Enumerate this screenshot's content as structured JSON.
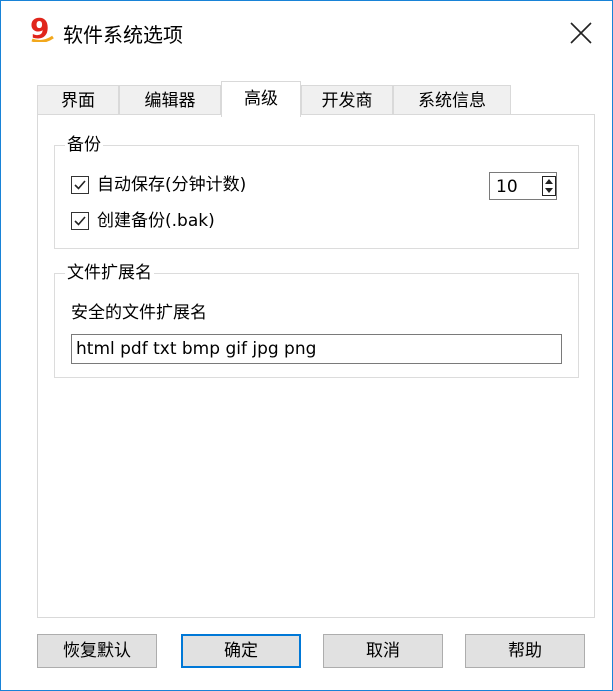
{
  "window": {
    "title": "软件系统选项",
    "app_icon_glyph": "9",
    "accent": "#1883d7"
  },
  "tabs": [
    {
      "label": "界面"
    },
    {
      "label": "编辑器"
    },
    {
      "label": "高级",
      "active": true
    },
    {
      "label": "开发商"
    },
    {
      "label": "系统信息"
    }
  ],
  "backup": {
    "title": "备份",
    "autosave_label": "自动保存(分钟计数)",
    "autosave_checked": true,
    "autosave_minutes": "10",
    "create_backup_label": "创建备份(.bak)",
    "create_backup_checked": true
  },
  "extensions": {
    "title": "文件扩展名",
    "safe_label": "安全的文件扩展名",
    "safe_value": "html pdf txt bmp gif jpg png"
  },
  "buttons": {
    "restore_defaults": "恢复默认",
    "ok": "确定",
    "cancel": "取消",
    "help": "帮助"
  }
}
